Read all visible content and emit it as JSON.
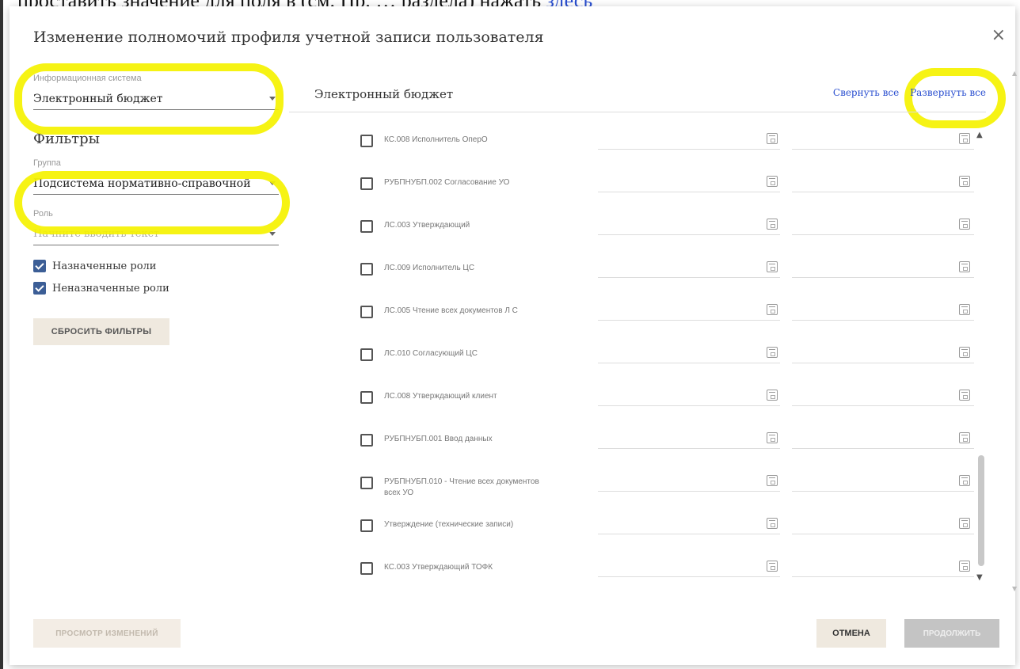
{
  "background": {
    "doc_text": "проставить значение для поля в (см. Пр. … раздела) нажать",
    "link_text": "здесь"
  },
  "dialog": {
    "title": "Изменение полномочий профиля учетной записи пользователя",
    "close_label": "×"
  },
  "left": {
    "info_system": {
      "label": "Информационная система",
      "value": "Электронный бюджет"
    },
    "filters_title": "Фильтры",
    "group": {
      "label": "Группа",
      "value": "Подсистема нормативно-справочной"
    },
    "role": {
      "label": "Роль",
      "placeholder": "Начните вводить текст"
    },
    "checkboxes": [
      {
        "label": "Назначенные роли",
        "checked": true
      },
      {
        "label": "Неназначенные роли",
        "checked": true
      }
    ],
    "reset_button": "СБРОСИТЬ ФИЛЬТРЫ"
  },
  "right": {
    "system_name": "Электронный бюджет",
    "collapse_all": "Свернуть все",
    "expand_all": "Развернуть все",
    "roles": [
      {
        "name": "КС.008 Исполнитель ОперО"
      },
      {
        "name": "РУБПНУБП.002 Согласование УО"
      },
      {
        "name": "ЛС.003 Утверждающий"
      },
      {
        "name": "ЛС.009 Исполнитель ЦС"
      },
      {
        "name": "ЛС.005 Чтение всех документов Л С"
      },
      {
        "name": "ЛС.010 Согласующий ЦС"
      },
      {
        "name": "ЛС.008 Утверждающий клиент"
      },
      {
        "name": "РУБПНУБП.001 Ввод данных"
      },
      {
        "name": "РУБПНУБП.010 - Чтение всех документов всех УО"
      },
      {
        "name": "Утверждение (технические записи)"
      },
      {
        "name": "КС.003 Утверждающий ТОФК"
      }
    ]
  },
  "footer": {
    "view_changes": "ПРОСМОТР ИЗМЕНЕНИЙ",
    "cancel": "ОТМЕНА",
    "continue": "ПРОДОЛЖИТЬ"
  },
  "colors": {
    "highlight": "#f5f200",
    "link": "#2a4fd0",
    "checkbox": "#3c5e96"
  }
}
